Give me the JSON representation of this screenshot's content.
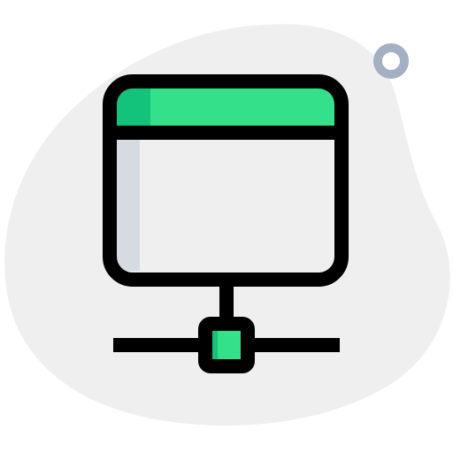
{
  "icon": {
    "name": "network-server-icon",
    "colors": {
      "blob": "#EFEFEF",
      "ring": "#A4AFC1",
      "header_green": "#34E089",
      "header_green_dark": "#13C37B",
      "window_body": "#EFEFEF",
      "window_shadow": "#D5DBE1",
      "node_green": "#34E089",
      "node_green_dark": "#13C37B",
      "outline": "#000000"
    }
  }
}
